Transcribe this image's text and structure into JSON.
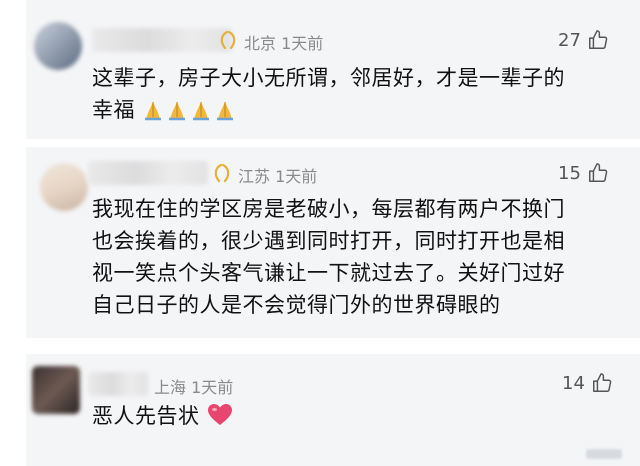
{
  "comments": [
    {
      "location": "北京",
      "time": "1天前",
      "likes": "27",
      "text_line1": "这辈子，房子大小无所谓，邻居好，才是一辈子的",
      "text_line2": "幸福"
    },
    {
      "location": "江苏",
      "time": "1天前",
      "likes": "15",
      "text_lines": [
        "我现在住的学区房是老破小，每层都有两户不换门",
        "也会挨着的，很少遇到同时打开，同时打开也是相",
        "视一笑点个头客气谦让一下就过去了。关好门过好",
        "自己日子的人是不会觉得门外的世界碍眼的"
      ]
    },
    {
      "location": "上海",
      "time": "1天前",
      "likes": "14",
      "text": "恶人先告状"
    }
  ],
  "icons": {
    "like": "thumbs-up-icon",
    "badge": "laurel-badge-icon",
    "pray": "folded-hands-emoji",
    "heart": "red-heart-emoji"
  },
  "colors": {
    "badge": "#e2b23b",
    "heart": "#e9466f",
    "card_bg": "#f4f5f7"
  }
}
